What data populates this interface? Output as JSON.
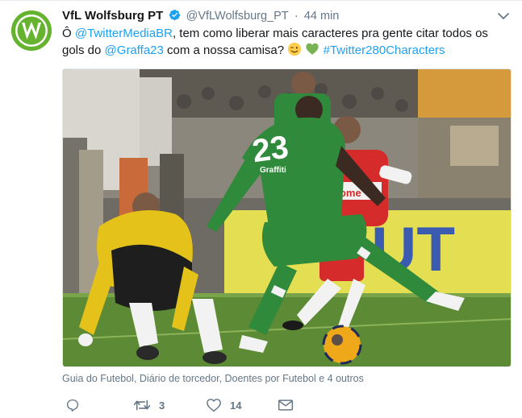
{
  "account": {
    "name": "VfL Wolfsburg PT",
    "handle": "@VfLWolfsburg_PT",
    "separator": "·",
    "time": "44 min",
    "brand_color": "#65b32e"
  },
  "tweet": {
    "text_intro": "Ô ",
    "mention_1": "@TwitterMediaBR",
    "text_mid": ", tem como liberar mais caracteres pra gente citar todos os gols do ",
    "mention_2": "@Graffa23",
    "text_end": " com a nossa camisa? ",
    "hashtag": "#Twitter280Characters"
  },
  "media": {
    "jersey_number": "23",
    "shirt_sponsor": "Graffiti",
    "board_text": "T-Home",
    "ad_text": "UT"
  },
  "caption": "Guia do Futebol, Diário de torcedor, Doentes por Futebol e 4 outros",
  "actions": {
    "reply_count": "",
    "retweet_count": "3",
    "like_count": "14"
  },
  "colors": {
    "link": "#1da1f2",
    "muted": "#657786",
    "pitch": "#5d8a34",
    "wolfsburg_kit": "#2f8a3c",
    "bayern_kit": "#d52b2b",
    "keeper_kit": "#e5c21a"
  },
  "icons": [
    "avatar-logo",
    "verified-badge-icon",
    "caret-down-icon",
    "wink-emoji-icon",
    "green-heart-icon",
    "reply-icon",
    "retweet-icon",
    "like-icon",
    "direct-message-icon"
  ]
}
